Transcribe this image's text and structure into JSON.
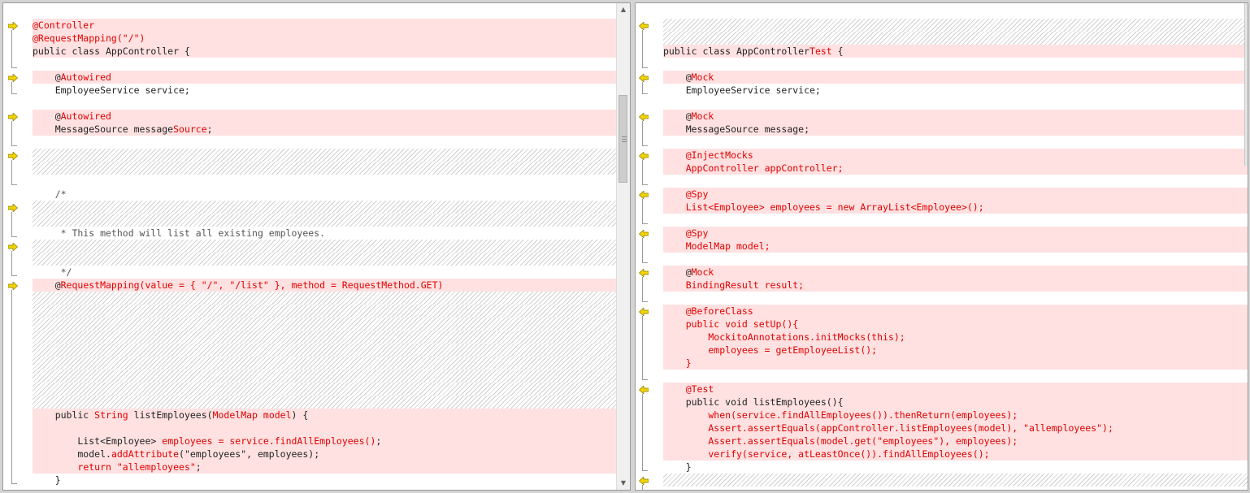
{
  "colors": {
    "changed_bg": "#ffe1e1",
    "highlight": "#e00000",
    "marker": "#f3d400"
  },
  "icons": {
    "left_marker": "arrow-right-icon",
    "right_marker": "arrow-left-icon",
    "bracket": "block-bracket-icon"
  },
  "left_pane": {
    "lines": [
      {
        "kind": "blank",
        "t": []
      },
      {
        "kind": "chg",
        "t": [
          [
            "@Controller",
            "hl"
          ]
        ]
      },
      {
        "kind": "chg",
        "t": [
          [
            "@RequestMapping(\"/\")",
            "hl"
          ]
        ]
      },
      {
        "kind": "chg",
        "t": [
          [
            "public class AppController {",
            ""
          ]
        ]
      },
      {
        "kind": "blank",
        "t": []
      },
      {
        "kind": "chg",
        "t": [
          [
            "    @",
            ""
          ],
          [
            "Autowired",
            "hl"
          ]
        ]
      },
      {
        "kind": "normal",
        "t": [
          [
            "    EmployeeService service;",
            ""
          ]
        ]
      },
      {
        "kind": "blank",
        "t": []
      },
      {
        "kind": "chg",
        "t": [
          [
            "    @",
            ""
          ],
          [
            "Autowired",
            "hl"
          ]
        ]
      },
      {
        "kind": "chg",
        "t": [
          [
            "    MessageSource message",
            ""
          ],
          [
            "Source",
            "hl"
          ],
          [
            ";",
            ""
          ]
        ]
      },
      {
        "kind": "blank",
        "t": []
      },
      {
        "kind": "hatch",
        "t": []
      },
      {
        "kind": "hatch",
        "t": []
      },
      {
        "kind": "blank",
        "t": []
      },
      {
        "kind": "normal",
        "t": [
          [
            "    /*",
            "cm"
          ]
        ]
      },
      {
        "kind": "hatch",
        "t": []
      },
      {
        "kind": "hatch",
        "t": []
      },
      {
        "kind": "normal",
        "t": [
          [
            "     * This method will list all existing employees.",
            "cm"
          ]
        ]
      },
      {
        "kind": "hatch",
        "t": []
      },
      {
        "kind": "hatch",
        "t": []
      },
      {
        "kind": "normal",
        "t": [
          [
            "     */",
            "cm"
          ]
        ]
      },
      {
        "kind": "chg",
        "t": [
          [
            "    @",
            ""
          ],
          [
            "RequestMapping(value = { \"/\", \"/list\" }, method = RequestMethod.GET)",
            "hl"
          ]
        ]
      },
      {
        "kind": "hatch",
        "t": []
      },
      {
        "kind": "hatch",
        "t": []
      },
      {
        "kind": "hatch",
        "t": []
      },
      {
        "kind": "hatch",
        "t": []
      },
      {
        "kind": "hatch",
        "t": []
      },
      {
        "kind": "hatch",
        "t": []
      },
      {
        "kind": "hatch",
        "t": []
      },
      {
        "kind": "hatch",
        "t": []
      },
      {
        "kind": "hatch",
        "t": []
      },
      {
        "kind": "chg",
        "t": [
          [
            "    public ",
            ""
          ],
          [
            "String",
            "hl"
          ],
          [
            " listEmployees(",
            ""
          ],
          [
            "ModelMap model",
            "hl"
          ],
          [
            ") {",
            ""
          ]
        ]
      },
      {
        "kind": "chg",
        "t": []
      },
      {
        "kind": "chg",
        "t": [
          [
            "        List",
            ""
          ],
          [
            "<Employee>",
            ""
          ],
          [
            " employees = service.findAllEmployees()",
            "hl"
          ],
          [
            ";",
            ""
          ]
        ]
      },
      {
        "kind": "chg",
        "t": [
          [
            "        model.",
            ""
          ],
          [
            "addAttribute",
            "hl"
          ],
          [
            "(\"employees\", employees);",
            ""
          ]
        ]
      },
      {
        "kind": "chg",
        "t": [
          [
            "        ",
            ""
          ],
          [
            "return \"allemployees\"",
            "hl"
          ],
          [
            ";",
            ""
          ]
        ]
      },
      {
        "kind": "normal",
        "t": [
          [
            "    }",
            ""
          ]
        ]
      },
      {
        "kind": "blank",
        "t": []
      },
      {
        "kind": "normal",
        "t": [
          [
            "    /*",
            "cm"
          ]
        ]
      }
    ]
  },
  "right_pane": {
    "lines": [
      {
        "kind": "blank",
        "t": []
      },
      {
        "kind": "hatch",
        "t": []
      },
      {
        "kind": "hatch",
        "t": []
      },
      {
        "kind": "chg",
        "t": [
          [
            "public class AppController",
            ""
          ],
          [
            "Test",
            "hl"
          ],
          [
            " {",
            ""
          ]
        ]
      },
      {
        "kind": "blank",
        "t": []
      },
      {
        "kind": "chg",
        "t": [
          [
            "    @",
            ""
          ],
          [
            "Mock",
            "hl"
          ]
        ]
      },
      {
        "kind": "normal",
        "t": [
          [
            "    EmployeeService service;",
            ""
          ]
        ]
      },
      {
        "kind": "blank",
        "t": []
      },
      {
        "kind": "chg",
        "t": [
          [
            "    @",
            ""
          ],
          [
            "Mock",
            "hl"
          ]
        ]
      },
      {
        "kind": "chg",
        "t": [
          [
            "    MessageSource message;",
            ""
          ]
        ]
      },
      {
        "kind": "blank",
        "t": []
      },
      {
        "kind": "chg",
        "t": [
          [
            "    @InjectMocks",
            "hl"
          ]
        ]
      },
      {
        "kind": "chg",
        "t": [
          [
            "    AppController appController;",
            "hl"
          ]
        ]
      },
      {
        "kind": "blank",
        "t": []
      },
      {
        "kind": "chg",
        "t": [
          [
            "    @Spy",
            "hl"
          ]
        ]
      },
      {
        "kind": "chg",
        "t": [
          [
            "    List<Employee> employees = new ArrayList<Employee>();",
            "hl"
          ]
        ]
      },
      {
        "kind": "blank",
        "t": []
      },
      {
        "kind": "chg",
        "t": [
          [
            "    @Spy",
            "hl"
          ]
        ]
      },
      {
        "kind": "chg",
        "t": [
          [
            "    ModelMap model;",
            "hl"
          ]
        ]
      },
      {
        "kind": "blank",
        "t": []
      },
      {
        "kind": "chg",
        "t": [
          [
            "    @",
            ""
          ],
          [
            "Mock",
            "hl"
          ]
        ]
      },
      {
        "kind": "chg",
        "t": [
          [
            "    BindingResult result;",
            "hl"
          ]
        ]
      },
      {
        "kind": "blank",
        "t": []
      },
      {
        "kind": "chg",
        "t": [
          [
            "    @BeforeClass",
            "hl"
          ]
        ]
      },
      {
        "kind": "chg",
        "t": [
          [
            "    public void setUp(){",
            "hl"
          ]
        ]
      },
      {
        "kind": "chg",
        "t": [
          [
            "        MockitoAnnotations.initMocks(this);",
            "hl"
          ]
        ]
      },
      {
        "kind": "chg",
        "t": [
          [
            "        employees = getEmployeeList();",
            "hl"
          ]
        ]
      },
      {
        "kind": "chg",
        "t": [
          [
            "    }",
            "hl"
          ]
        ]
      },
      {
        "kind": "blank",
        "t": []
      },
      {
        "kind": "chg",
        "t": [
          [
            "    @Test",
            "hl"
          ]
        ]
      },
      {
        "kind": "chg",
        "t": [
          [
            "    public void listEmployees(){",
            ""
          ]
        ]
      },
      {
        "kind": "chg",
        "t": [
          [
            "        when(service.findAllEmployees()).thenReturn(employees);",
            "hl"
          ]
        ]
      },
      {
        "kind": "chg",
        "t": [
          [
            "        Assert.assertEquals(appController.listEmployees(model), \"allemployees\");",
            "hl"
          ]
        ]
      },
      {
        "kind": "chg",
        "t": [
          [
            "        Assert.assertEquals(model.get(\"employees\"), employees);",
            "hl"
          ]
        ]
      },
      {
        "kind": "chg",
        "t": [
          [
            "        verify(service, atLeastOnce()).findAllEmployees();",
            "hl"
          ]
        ]
      },
      {
        "kind": "normal",
        "t": [
          [
            "    }",
            ""
          ]
        ]
      },
      {
        "kind": "hatch",
        "t": []
      },
      {
        "kind": "blank",
        "t": []
      }
    ]
  }
}
